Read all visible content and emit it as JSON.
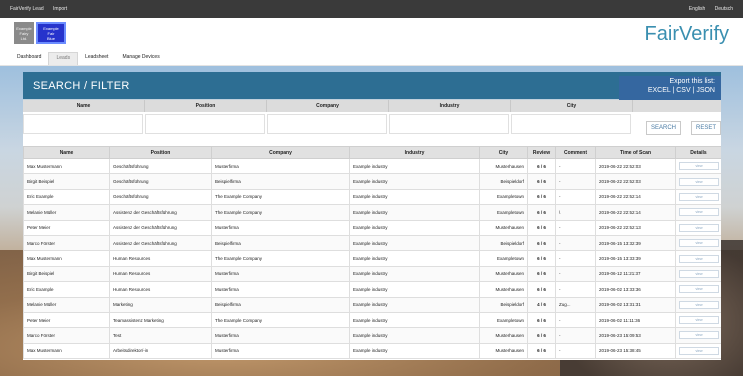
{
  "topbar": {
    "left_items": [
      "FairVerify Lead",
      "Import"
    ],
    "right_items": [
      "English",
      "Deutsch"
    ]
  },
  "header": {
    "logo1_text": "Example\nFairy\nLtd.",
    "logo2_text": "Example\nFair\nBlue",
    "brand": "FairVerify"
  },
  "nav": {
    "tabs": [
      "Dashboard",
      "Leads",
      "Leadsheet",
      "Manage Devices"
    ],
    "active": "Leads"
  },
  "search": {
    "title": "SEARCH / FILTER",
    "export_line1": "Export this list:",
    "export_line2": "EXCEL | CSV | JSON",
    "filter_labels": [
      "Name",
      "Position",
      "Company",
      "Industry",
      "City"
    ],
    "search_button": "SEARCH",
    "reset_button": "RESET"
  },
  "table": {
    "headers": [
      "Name",
      "Position",
      "Company",
      "Industry",
      "City",
      "Review",
      "Comment",
      "Time of Scan",
      "Details"
    ],
    "detail_label": "view",
    "rows": [
      [
        "Max Mustermann",
        "Geschäftsführung",
        "Musterfirma",
        "Example industry",
        "Musterhausen",
        "6 / 6",
        "-",
        "2019-06-22 22:52:03"
      ],
      [
        "Birgit Beispiel",
        "Geschäftsführung",
        "Beispielfirma",
        "Example industry",
        "Beispieldorf",
        "6 / 6",
        "-",
        "2019-06-22 22:52:03"
      ],
      [
        "Eric Example",
        "Geschäftsführung",
        "The Example Company",
        "Example industry",
        "Exampletown",
        "6 / 6",
        "-",
        "2019-06-22 22:52:14"
      ],
      [
        "Melanie Müller",
        "Assistenz der Geschäftsführung",
        "The Example Company",
        "Example industry",
        "Exampletown",
        "6 / 6",
        "\\",
        "2019-06-22 22:52:14"
      ],
      [
        "Peter Meier",
        "Assistenz der Geschäftsführung",
        "Musterfirma",
        "Example industry",
        "Musterhausen",
        "6 / 6",
        "-",
        "2019-06-22 22:52:13"
      ],
      [
        "Marco Förster",
        "Assistenz der Geschäftsführung",
        "Beispielfirma",
        "Example industry",
        "Beispieldorf",
        "6 / 6",
        "-",
        "2019-06-15 13:32:39"
      ],
      [
        "Max Mustermann",
        "Human Resources",
        "The Example Company",
        "Example industry",
        "Exampletown",
        "6 / 6",
        "-",
        "2019-06-15 13:33:39"
      ],
      [
        "Birgit Beispiel",
        "Human Resources",
        "Musterfirma",
        "Example industry",
        "Musterhausen",
        "6 / 6",
        "-",
        "2019-06-12 11:21:37"
      ],
      [
        "Eric Example",
        "Human Resources",
        "Musterfirma",
        "Example industry",
        "Musterhausen",
        "6 / 6",
        "-",
        "2019-06-02 13:33:36"
      ],
      [
        "Melanie Müller",
        "Marketing",
        "Beispielfirma",
        "Example industry",
        "Beispieldorf",
        "4 / 6",
        "Zug...",
        "2019-06-02 13:31:31"
      ],
      [
        "Peter Meier",
        "Teamassistenz Marketing",
        "The Example Company",
        "Example industry",
        "Exampletown",
        "6 / 6",
        "-",
        "2019-06-02 11:11:36"
      ],
      [
        "Marco Förster",
        "Test",
        "Musterfirma",
        "Example industry",
        "Musterhausen",
        "6 / 6",
        "-",
        "2019-06-23 15:09:53"
      ],
      [
        "Max Mustermann",
        "Arbeitsdirektor/-in",
        "Musterfirma",
        "Example industry",
        "Musterhausen",
        "6 / 6",
        "-",
        "2019-06-23 15:38:45"
      ]
    ]
  },
  "colors": {
    "topbar": "#3a3a3a",
    "panel_head": "#2d6e93",
    "export_box": "#3567a0",
    "brand": "#3a8fb0"
  }
}
